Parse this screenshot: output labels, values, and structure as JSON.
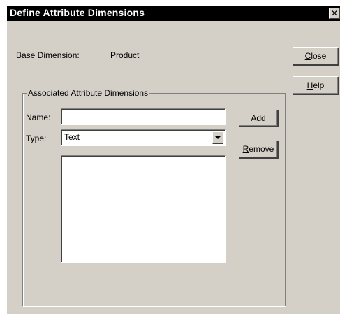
{
  "dialog": {
    "title": "Define Attribute Dimensions",
    "close_glyph": "✕"
  },
  "base": {
    "label": "Base Dimension:",
    "value": "Product"
  },
  "group": {
    "legend": "Associated Attribute Dimensions"
  },
  "name_field": {
    "label": "Name:",
    "value": ""
  },
  "type_field": {
    "label": "Type:",
    "selected": "Text"
  },
  "buttons": {
    "close": {
      "accel": "C",
      "rest": "lose"
    },
    "help": {
      "accel": "H",
      "rest": "elp"
    },
    "add": {
      "accel": "A",
      "rest": "dd"
    },
    "remove": {
      "accel": "R",
      "rest": "emove"
    }
  },
  "attribute_list": {
    "items": []
  },
  "icons": {
    "close": "close-icon",
    "dropdown": "chevron-down-icon"
  }
}
